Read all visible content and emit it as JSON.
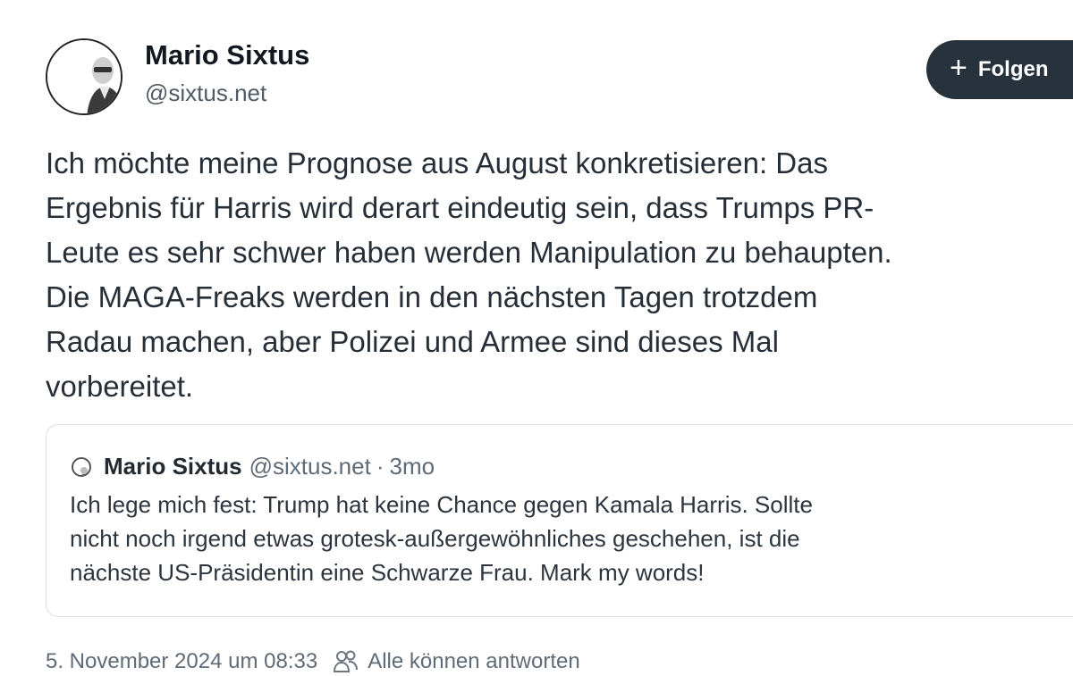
{
  "author": {
    "display_name": "Mario Sixtus",
    "handle": "@sixtus.net"
  },
  "follow_button": {
    "plus": "+",
    "label": "Folgen"
  },
  "post": {
    "lines": [
      "Ich möchte meine Prognose aus August konkretisieren: Das",
      "Ergebnis für Harris wird derart eindeutig sein, dass Trumps PR-",
      "Leute es sehr schwer haben werden Manipulation zu behaupten.",
      "Die MAGA-Freaks werden in den nächsten Tagen trotzdem",
      "Radau machen, aber Polizei und Armee sind dieses Mal",
      "vorbereitet."
    ]
  },
  "quote": {
    "display_name": "Mario Sixtus",
    "handle": "@sixtus.net",
    "separator": "·",
    "time": "3mo",
    "lines": [
      "Ich lege mich fest: Trump hat keine Chance gegen Kamala Harris. Sollte",
      "nicht noch irgend etwas grotesk-außergewöhnliches geschehen, ist die",
      "nächste US-Präsidentin eine Schwarze Frau. Mark my words!"
    ]
  },
  "footer": {
    "timestamp": "5. November 2024 um 08:33",
    "reply_icon": "people-icon",
    "reply_setting": "Alle können antworten"
  },
  "colors": {
    "follow_button_bg": "#28323c",
    "text_primary": "#262f38",
    "text_secondary": "#5f6b76",
    "card_border": "#d9dee3"
  }
}
